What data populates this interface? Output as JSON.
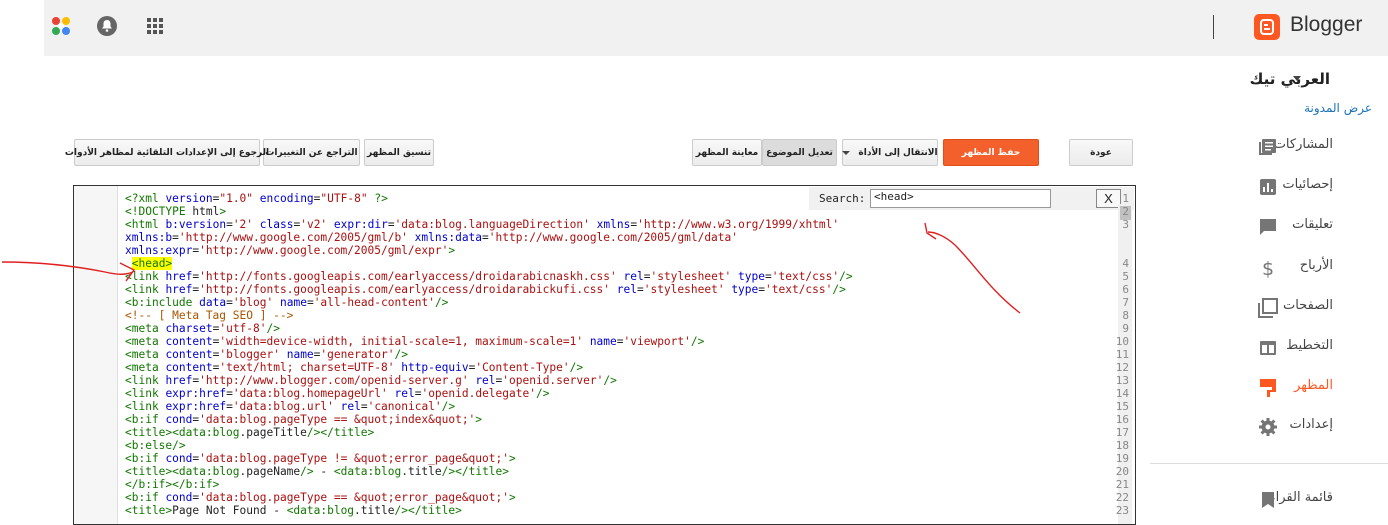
{
  "app": {
    "name": "Blogger"
  },
  "colors": {
    "brand": "#ff5722",
    "accent_link": "#1a73b8",
    "active_nav": "#ff5722"
  },
  "topbar": {
    "icons": [
      "apps-color-icon",
      "notifications-icon",
      "apps-grid-icon"
    ]
  },
  "sidebar": {
    "blog_name": "العربي تيك",
    "view_blog": "عرض المدونة",
    "items": [
      {
        "label": "المشاركات",
        "icon": "posts-icon"
      },
      {
        "label": "إحصائيات",
        "icon": "stats-icon"
      },
      {
        "label": "تعليقات",
        "icon": "comments-icon"
      },
      {
        "label": "الأرباح",
        "icon": "earnings-icon"
      },
      {
        "label": "الصفحات",
        "icon": "pages-icon"
      },
      {
        "label": "التخطيط",
        "icon": "layout-icon"
      },
      {
        "label": "المظهر",
        "icon": "theme-icon",
        "active": true
      },
      {
        "label": "إعدادات",
        "icon": "settings-icon"
      },
      {
        "label": "قائمة القراءة",
        "icon": "reading-list-icon"
      }
    ]
  },
  "toolbar": {
    "back": "عودة",
    "save_theme": "حفظ المظهر",
    "jump_to_widget": "الانتقال إلى الأداة",
    "edit_theme": "تعديل الموضوع",
    "preview_theme": "معاينة المظهر",
    "format_theme": "تنسيق المظهر",
    "revert_changes": "التراجع عن التغييرات",
    "revert_widgets": "الرجوع إلى الإعدادات التلقائية لمظاهر الأدوات"
  },
  "editor": {
    "search_label": "Search:",
    "search_value": "<head>",
    "close_label": "X",
    "line_numbers": [
      "1",
      "2",
      "3",
      "",
      "",
      "4",
      "5",
      "6",
      "7",
      "8",
      "9",
      "10",
      "11",
      "12",
      "13",
      "14",
      "15",
      "16",
      "17",
      "18",
      "19",
      "20",
      "21",
      "22",
      "23"
    ],
    "lines": [
      "<?xml version=\"1.0\" encoding=\"UTF-8\" ?>",
      "<!DOCTYPE html>",
      "<html b:version='2' class='v2' expr:dir='data:blog.languageDirection' xmlns='http://www.w3.org/1999/xhtml'",
      "xmlns:b='http://www.google.com/2005/gml/b' xmlns:data='http://www.google.com/2005/gml/data'",
      "xmlns:expr='http://www.google.com/2005/gml/expr'>",
      " <head>",
      "<link href='http://fonts.googleapis.com/earlyaccess/droidarabicnaskh.css' rel='stylesheet' type='text/css'/>",
      "<link href='http://fonts.googleapis.com/earlyaccess/droidarabickufi.css' rel='stylesheet' type='text/css'/>",
      "<b:include data='blog' name='all-head-content'/>",
      "<!-- [ Meta Tag SEO ] -->",
      "<meta charset='utf-8'/>",
      "<meta content='width=device-width, initial-scale=1, maximum-scale=1' name='viewport'/>",
      "<meta content='blogger' name='generator'/>",
      "<meta content='text/html; charset=UTF-8' http-equiv='Content-Type'/>",
      "<link href='http://www.blogger.com/openid-server.g' rel='openid.server'/>",
      "<link expr:href='data:blog.homepageUrl' rel='openid.delegate'/>",
      "<link expr:href='data:blog.url' rel='canonical'/>",
      "<b:if cond='data:blog.pageType == &quot;index&quot;'>",
      "<title><data:blog.pageTitle/></title>",
      "<b:else/>",
      "<b:if cond='data:blog.pageType != &quot;error_page&quot;'>",
      "<title><data:blog.pageName/> - <data:blog.title/></title>",
      "</b:if></b:if>",
      "<b:if cond='data:blog.pageType == &quot;error_page&quot;'>",
      "<title>Page Not Found - <data:blog.title/></title>"
    ]
  }
}
